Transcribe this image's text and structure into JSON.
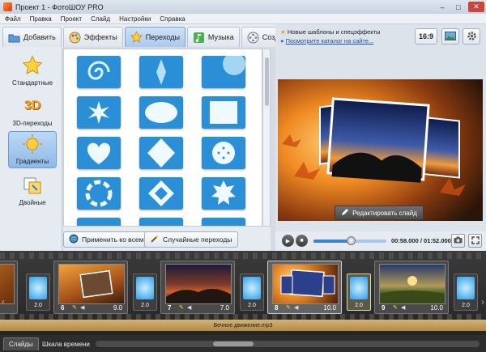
{
  "window": {
    "title": "Проект 1 - ФотоШОУ PRO",
    "min": "–",
    "max": "□",
    "close": "✕"
  },
  "menu": [
    "Файл",
    "Правка",
    "Проект",
    "Слайд",
    "Настройки",
    "Справка"
  ],
  "tabs": [
    {
      "label": "Добавить",
      "icon": "folder-icon"
    },
    {
      "label": "Эффекты",
      "icon": "palette-icon"
    },
    {
      "label": "Переходы",
      "icon": "star-icon",
      "active": true
    },
    {
      "label": "Музыка",
      "icon": "music-note-icon"
    },
    {
      "label": "Создать",
      "icon": "film-reel-icon"
    }
  ],
  "categories": [
    {
      "label": "Стандартные",
      "icon": "star-icon"
    },
    {
      "label": "3D-переходы",
      "icon": "3d-icon",
      "glyph": "3D"
    },
    {
      "label": "Градиенты",
      "icon": "sun-icon",
      "active": true
    },
    {
      "label": "Двойные",
      "icon": "double-icon"
    }
  ],
  "grid_buttons": {
    "apply_all": "Применить ко всем",
    "random": "Случайные переходы"
  },
  "promo": {
    "line1": "Новые шаблоны и спецэффекты",
    "line2": "Посмотрите каталог на сайте..."
  },
  "aspect_label": "16:9",
  "edit_slide_label": "Редактировать слайд",
  "player": {
    "time_current": "00:58.000",
    "time_separator": " / ",
    "time_total": "01:52.000",
    "progress": 0.51
  },
  "timeline": {
    "slides": [
      {
        "number": "",
        "duration": ""
      },
      {
        "number": "6",
        "duration": "9.0"
      },
      {
        "number": "7",
        "duration": "7.0"
      },
      {
        "number": "8",
        "duration": "10.0",
        "active": true
      },
      {
        "number": "9",
        "duration": "10.0"
      }
    ],
    "transitions": [
      {
        "duration": "2.0"
      },
      {
        "duration": "2.0"
      },
      {
        "duration": "2.0"
      },
      {
        "duration": "2.0",
        "active": true
      },
      {
        "duration": "2.0"
      }
    ],
    "audio_track": "Вечное движение.mp3"
  },
  "bottom_tabs": [
    "Слайды",
    "Шкала времени"
  ],
  "colors": {
    "accent": "#3a82d6",
    "timeline_bg": "#2e2e2e",
    "audio": "#c9a15e"
  }
}
